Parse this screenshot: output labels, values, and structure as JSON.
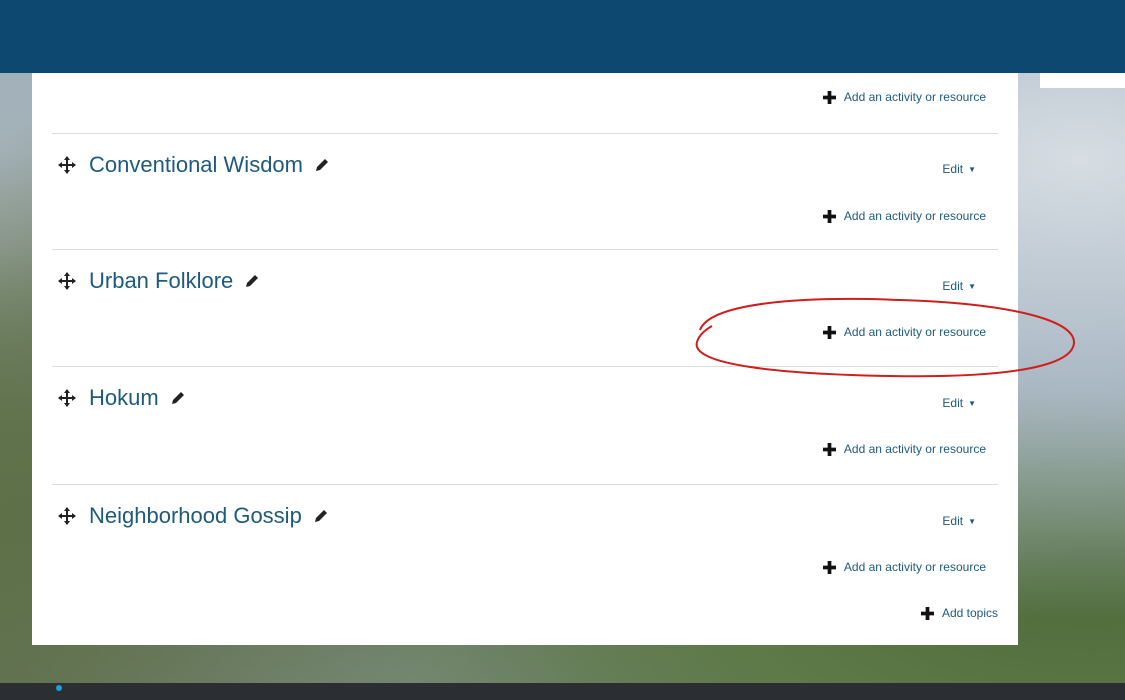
{
  "colors": {
    "header": "#0d4870",
    "link": "#1d5a7e",
    "annotation": "#d01e1e",
    "footer": "#2b2f33"
  },
  "top_section": {
    "add_label": "Add an activity or resource"
  },
  "sections": [
    {
      "title": "Conventional Wisdom",
      "edit_label": "Edit",
      "add_label": "Add an activity or resource"
    },
    {
      "title": "Urban Folklore",
      "edit_label": "Edit",
      "add_label": "Add an activity or resource"
    },
    {
      "title": "Hokum",
      "edit_label": "Edit",
      "add_label": "Add an activity or resource"
    },
    {
      "title": "Neighborhood Gossip",
      "edit_label": "Edit",
      "add_label": "Add an activity or resource"
    }
  ],
  "add_topics_label": "Add topics",
  "icons": {
    "move": "move-icon",
    "edit": "pencil-icon",
    "add": "plus-icon",
    "caret": "caret-down-icon"
  },
  "annotation": {
    "shape": "ellipse",
    "highlights": "sections.1.add_label"
  }
}
